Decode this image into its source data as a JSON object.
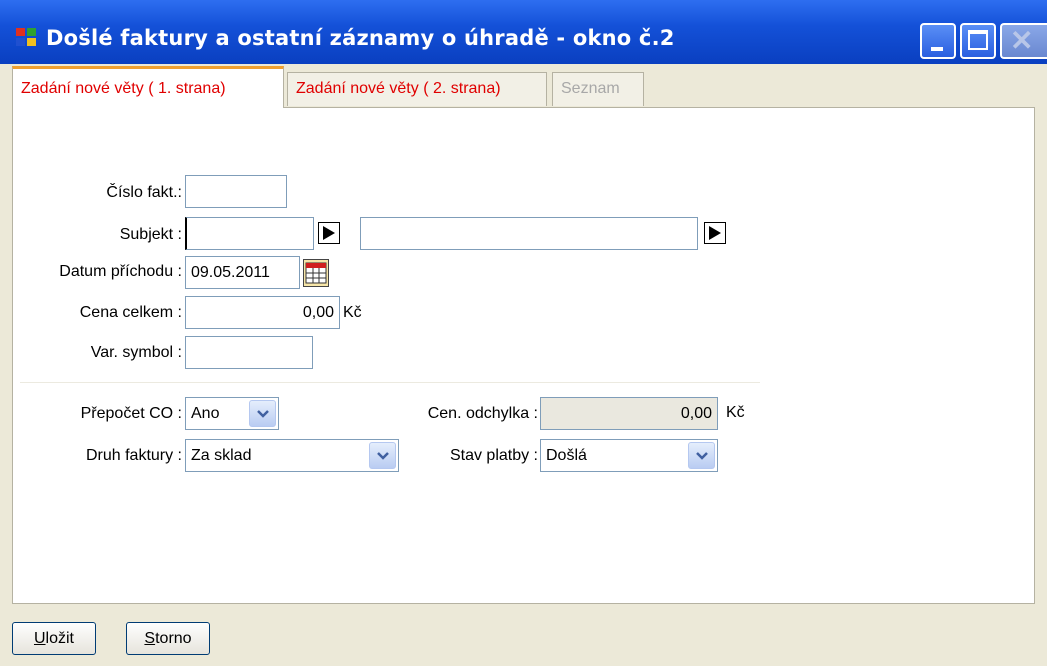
{
  "window": {
    "title": "Došlé faktury a ostatní záznamy o úhradě - okno č.2",
    "icons": [
      "app-icon",
      "minimize-icon",
      "maximize-icon",
      "close-icon"
    ]
  },
  "tabs": [
    {
      "label": "Zadání nové věty ( 1. strana)",
      "state": "active"
    },
    {
      "label": "Zadání nové věty ( 2. strana)",
      "state": "normal"
    },
    {
      "label": "Seznam",
      "state": "disabled"
    }
  ],
  "form": {
    "cislo_fakt": {
      "label": "Číslo fakt.:",
      "value": ""
    },
    "subjekt": {
      "label": "Subjekt :",
      "value": "",
      "name_value": ""
    },
    "datum_prichodu": {
      "label": "Datum příchodu :",
      "value": "09.05.2011"
    },
    "cena_celkem": {
      "label": "Cena celkem :",
      "value": "0,00",
      "unit": "Kč"
    },
    "var_symbol": {
      "label": "Var. symbol :",
      "value": ""
    },
    "prepocet_co": {
      "label": "Přepočet CO :",
      "value": "Ano"
    },
    "druh_faktury": {
      "label": "Druh faktury :",
      "value": "Za sklad"
    },
    "cen_odchylka": {
      "label": "Cen. odchylka :",
      "value": "0,00",
      "unit": "Kč"
    },
    "stav_platby": {
      "label": "Stav platby :",
      "value": "Došlá"
    }
  },
  "buttons": {
    "save_first": "U",
    "save_rest": "ložit",
    "cancel_first": "S",
    "cancel_rest": "torno"
  },
  "colors": {
    "titlebar": "#1451d8",
    "tab_text": "#e00000",
    "active_tab_accent": "#f0a030",
    "window_bg": "#ece9d8"
  }
}
